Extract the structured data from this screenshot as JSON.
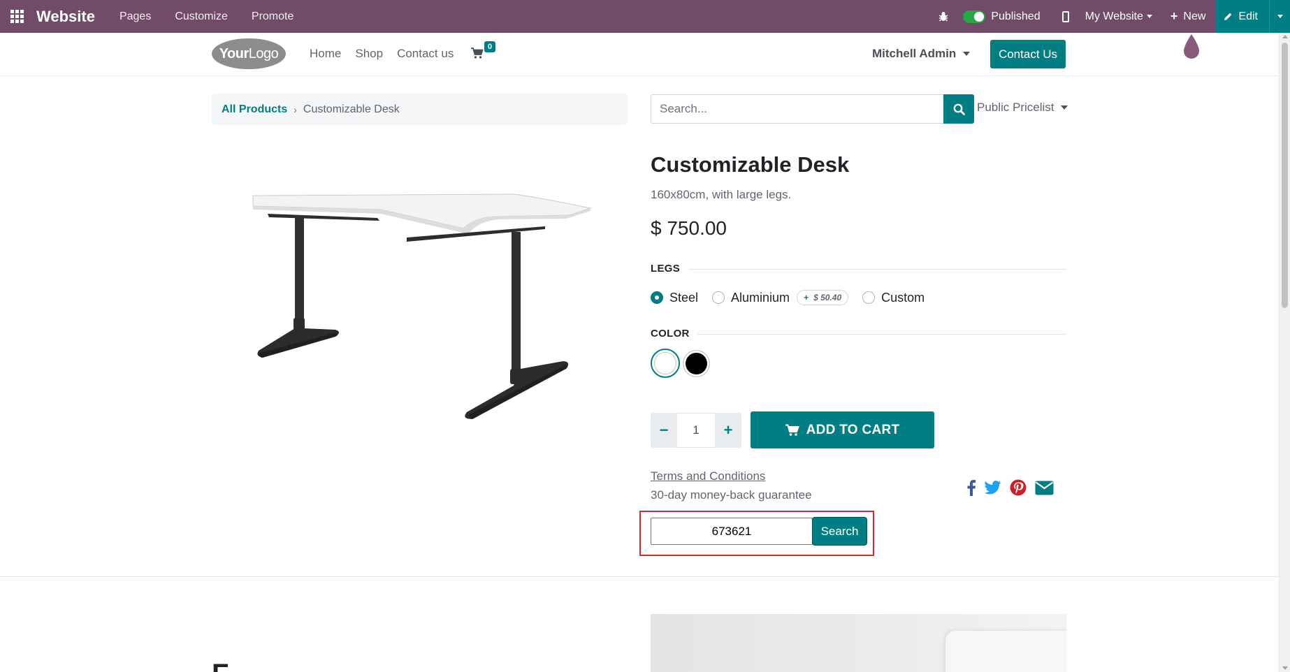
{
  "topbar": {
    "brand": "Website",
    "menu": [
      "Pages",
      "Customize",
      "Promote"
    ],
    "published_label": "Published",
    "published": true,
    "my_website": "My Website",
    "new_label": "New",
    "edit_label": "Edit",
    "bg_color": "#714b67"
  },
  "header": {
    "logo_text_bold": "Your",
    "logo_text": "Logo",
    "nav": [
      "Home",
      "Shop",
      "Contact us"
    ],
    "cart_count": "0",
    "user": "Mitchell Admin",
    "contact_button": "Contact Us"
  },
  "breadcrumb": {
    "parent": "All Products",
    "current": "Customizable Desk"
  },
  "search": {
    "placeholder": "Search...",
    "pricelist": "Public Pricelist"
  },
  "product": {
    "name": "Customizable Desk",
    "description": "160x80cm, with large legs.",
    "price": "$ 750.00",
    "attributes": {
      "legs": {
        "label": "LEGS",
        "options": [
          {
            "label": "Steel",
            "checked": true
          },
          {
            "label": "Aluminium",
            "checked": false,
            "extra_sign": "+",
            "extra_price": "$ 50.40"
          },
          {
            "label": "Custom",
            "checked": false
          }
        ]
      },
      "color": {
        "label": "COLOR",
        "options": [
          {
            "name": "White",
            "hex": "#ffffff",
            "selected": true
          },
          {
            "name": "Black",
            "hex": "#000000",
            "selected": false
          }
        ]
      }
    },
    "quantity": "1",
    "add_to_cart": "ADD TO CART",
    "terms": "Terms and Conditions",
    "guarantee": "30-day money-back guarantee"
  },
  "share_icons": [
    "facebook-icon",
    "twitter-icon",
    "pinterest-icon",
    "envelope-icon"
  ],
  "injected_form": {
    "input_value": "673621",
    "button": "Search"
  },
  "lower_section": {
    "heading": "F"
  },
  "colors": {
    "accent": "#017e84",
    "highlight_border": "#e0242a"
  }
}
